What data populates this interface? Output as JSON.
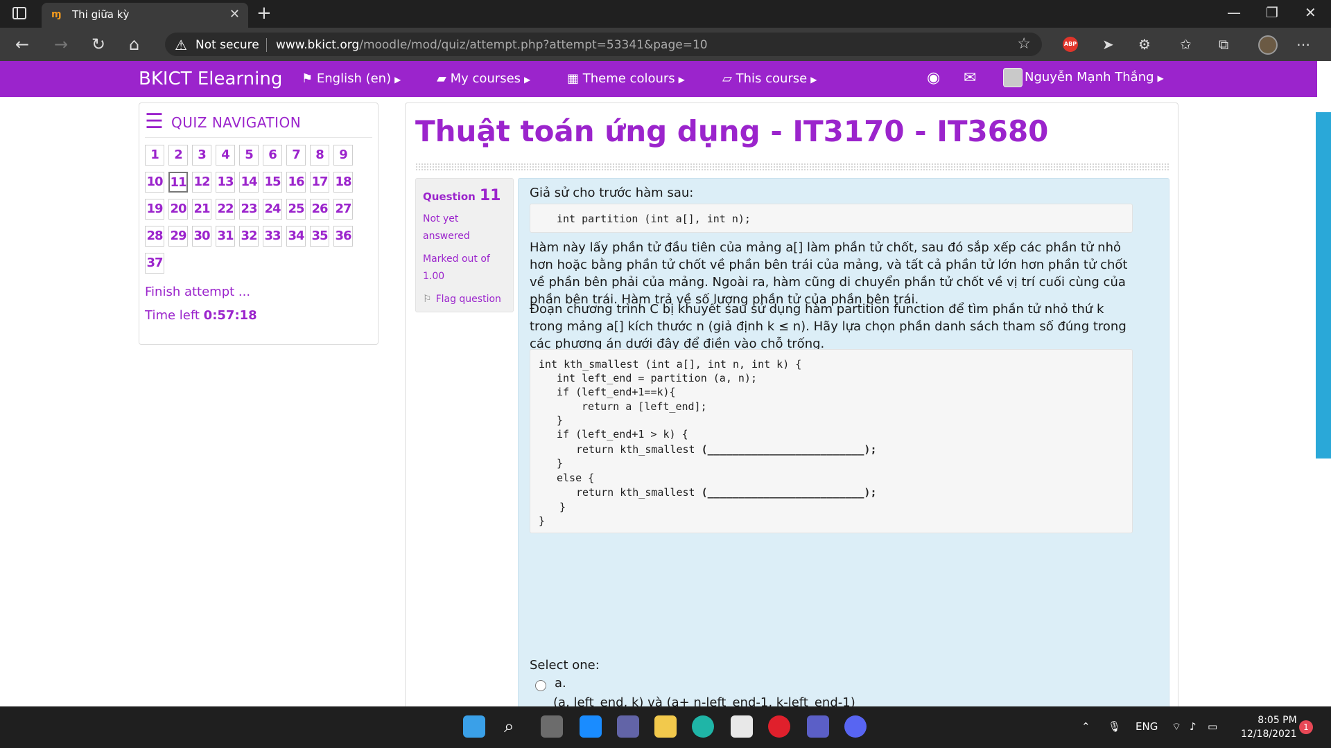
{
  "browser": {
    "tab_title": "Thi giữa kỳ",
    "tab_favicon": "moodle-icon",
    "security_label": "Not secure",
    "url_host": "www.bkict.org",
    "url_path": "/moodle/mod/quiz/attempt.php?attempt=53341&page=10"
  },
  "navbar": {
    "brand": "BKICT Elearning",
    "language": "English (en)",
    "my_courses": "My courses",
    "theme_colours": "Theme colours",
    "this_course": "This course",
    "user_name": "Nguyễn Mạnh Thắng",
    "accent_color": "#9b24cc"
  },
  "quiz_nav": {
    "title": "QUIZ NAVIGATION",
    "questions": [
      "1",
      "2",
      "3",
      "4",
      "5",
      "6",
      "7",
      "8",
      "9",
      "10",
      "11",
      "12",
      "13",
      "14",
      "15",
      "16",
      "17",
      "18",
      "19",
      "20",
      "21",
      "22",
      "23",
      "24",
      "25",
      "26",
      "27",
      "28",
      "29",
      "30",
      "31",
      "32",
      "33",
      "34",
      "35",
      "36",
      "37"
    ],
    "current": "11",
    "finish_label": "Finish attempt ...",
    "time_left_label": "Time left",
    "time_left_value": "0:57:18"
  },
  "main": {
    "course_title": "Thuật toán ứng dụng - IT3170 - IT3680",
    "question_label": "Question",
    "question_number": "11",
    "state_text": "Not yet answered",
    "marks_text": "Marked out of 1.00",
    "flag_label": "Flag question",
    "intro": "Giả sử cho trước hàm sau:",
    "signature": "int partition (int a[], int n);",
    "paragraph1": "Hàm này lấy phần tử đầu tiên của mảng a[] làm phần tử chốt, sau đó sắp xếp các phần tử nhỏ hơn hoặc bằng phần tử chốt về  phần bên trái của mảng, và tất cả phần tử lớn hơn phần tử chốt về phần bên phải của mảng. Ngoài ra, hàm cũng di chuyển phần tử chốt về vị trí cuối cùng của phần bên trái. Hàm trả về số lượng phần tử của phần bên trái.",
    "paragraph2": "Đoạn chương trình C bị khuyết sau sử dụng hàm partition function để tìm phần tử nhỏ thứ k trong mảng a[] kích thước n (giả định k ≤ n). Hãy lựa chọn phần danh sách tham số đúng trong các phương án dưới đây để điền vào chỗ trống.",
    "code": {
      "l1": "int kth_smallest (int a[], int n, int k) {",
      "l2": "int left_end = partition (a, n);",
      "l3": "if (left_end+1==k){",
      "l4": "return a [left_end];",
      "l5": "}",
      "l6": "if (left_end+1 > k) {",
      "l7": "return kth_smallest ",
      "l8": "}",
      "l9": "else {",
      "l10": "return kth_smallest ",
      "l11": "}",
      "l12": "}",
      "blank": "(_________________________);"
    },
    "select_one": "Select one:",
    "option_a_letter": "a.",
    "option_a_text": "(a, left_end, k) và (a+ n-left_end-1, k-left_end-1)"
  },
  "taskbar": {
    "language": "ENG",
    "time": "8:05 PM",
    "date": "12/18/2021",
    "notifications": "1"
  }
}
